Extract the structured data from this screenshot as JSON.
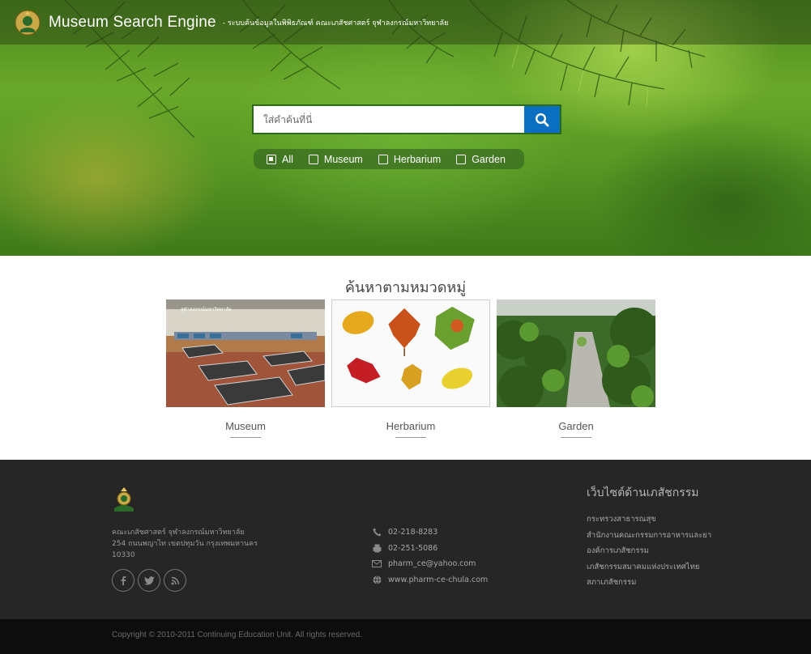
{
  "header": {
    "brand": "Museum Search Engine",
    "tagline": "- ระบบค้นข้อมูลในพิพิธภัณฑ์ คณะเภสัชศาสตร์ จุฬาลงกรณ์มหาวิทยาลัย"
  },
  "search": {
    "placeholder": "ใส่คำค้นที่นี่",
    "button_icon": "search-icon"
  },
  "filters": [
    {
      "label": "All",
      "checked": true
    },
    {
      "label": "Museum",
      "checked": false
    },
    {
      "label": "Herbarium",
      "checked": false
    },
    {
      "label": "Garden",
      "checked": false
    }
  ],
  "categories": {
    "title": "ค้นหาตามหมวดหมู่",
    "items": [
      {
        "label": "Museum"
      },
      {
        "label": "Herbarium"
      },
      {
        "label": "Garden"
      }
    ]
  },
  "footer": {
    "address": [
      "คณะเภสัชศาสตร์ จุฬาลงกรณ์มหาวิทยาลัย",
      "254 ถนนพญาไท เขตปทุมวัน กรุงเทพมหานคร",
      "10330"
    ],
    "socials": [
      "facebook-icon",
      "twitter-icon",
      "rss-icon"
    ],
    "contacts": [
      {
        "icon": "phone-icon",
        "text": "02-218-8283"
      },
      {
        "icon": "fax-icon",
        "text": "02-251-5086"
      },
      {
        "icon": "mail-icon",
        "text": "pharm_ce@yahoo.com"
      },
      {
        "icon": "globe-icon",
        "text": "www.pharm-ce-chula.com"
      }
    ],
    "links_title": "เว็บไซต์ด้านเภสัชกรรม",
    "links": [
      "กระทรวงสาธารณสุข",
      "สำนักงานคณะกรรมการอาหารและยา",
      "องค์การเภสัชกรรม",
      "เภสัชกรรมสมาคมแห่งประเทศไทย",
      "สภาเภสัชกรรม"
    ],
    "copyright": "Copyright © 2010-2011 Continuing Education Unit. All rights reserved."
  },
  "colors": {
    "search_button": "#0a6ec1",
    "footer_bg": "#262626",
    "copy_bg": "#0d0d0d"
  }
}
